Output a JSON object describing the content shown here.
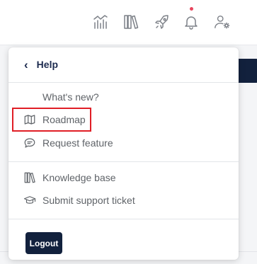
{
  "colors": {
    "navy": "#12213d",
    "accent_red": "#e01e26",
    "notification_dot": "#e8455d",
    "icon_gray": "#7d8188"
  },
  "topbar": {
    "icons": [
      "analytics-icon",
      "library-icon",
      "rocket-icon",
      "bell-icon",
      "user-settings-icon"
    ]
  },
  "menu": {
    "back_glyph": "‹",
    "title": "Help",
    "items": [
      {
        "label": "What's new?",
        "icon": "none"
      },
      {
        "label": "Roadmap",
        "icon": "map-icon",
        "highlighted": true
      },
      {
        "label": "Request feature",
        "icon": "chat-bubble-icon"
      },
      {
        "label": "Knowledge base",
        "icon": "books-icon"
      },
      {
        "label": "Submit support ticket",
        "icon": "graduation-cap-icon"
      }
    ],
    "logout_label": "Logout"
  }
}
